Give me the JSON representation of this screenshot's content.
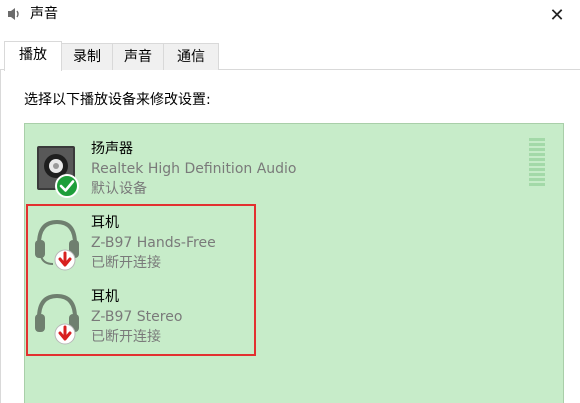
{
  "window": {
    "title": "声音",
    "icon": "speaker-icon"
  },
  "tabs": [
    {
      "label": "播放",
      "active": true
    },
    {
      "label": "录制",
      "active": false
    },
    {
      "label": "声音",
      "active": false
    },
    {
      "label": "通信",
      "active": false
    }
  ],
  "panel": {
    "instruction": "选择以下播放设备来修改设置:"
  },
  "devices": [
    {
      "name": "扬声器",
      "description": "Realtek High Definition Audio",
      "status": "默认设备",
      "icon": "speaker-icon",
      "badge": "default-check-icon"
    },
    {
      "name": "耳机",
      "description": "Z-B97 Hands-Free",
      "status": "已断开连接",
      "icon": "headset-icon",
      "badge": "disconnected-arrow-icon"
    },
    {
      "name": "耳机",
      "description": "Z-B97 Stereo",
      "status": "已断开连接",
      "icon": "headset-icon",
      "badge": "disconnected-arrow-icon"
    }
  ],
  "colors": {
    "list_background": "#c7ecc9",
    "highlight_border": "#e33030",
    "secondary_text": "#7a7a7a",
    "check_badge": "#1e9e3a",
    "disconnect_badge": "#d81f1f"
  }
}
